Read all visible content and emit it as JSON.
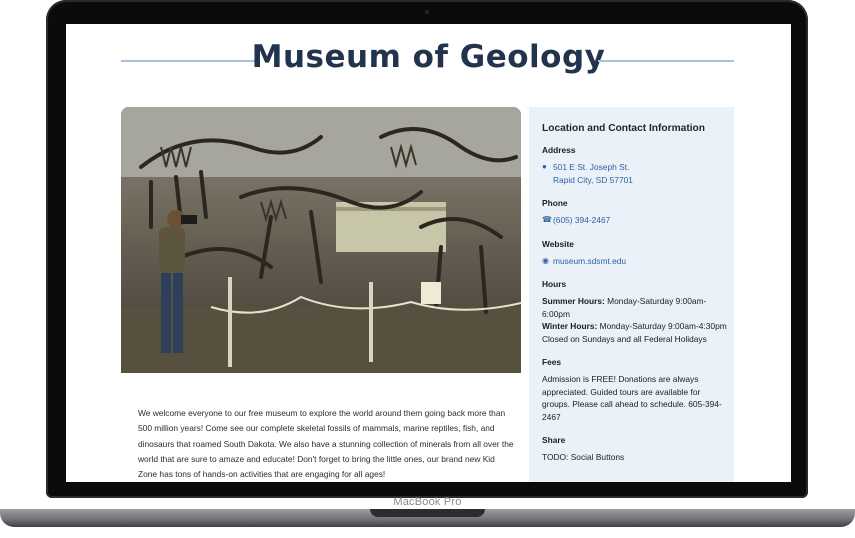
{
  "device": {
    "label": "MacBook Pro"
  },
  "page": {
    "title": "Museum of Geology"
  },
  "hero": {
    "alt": "Fossil skeletons exhibit with a visitor photographing"
  },
  "intro": {
    "text": "We welcome everyone to our free museum to explore the world around them going back more than 500 million years! Come see our complete skeletal fossils of mammals, marine reptiles, fish, and dinosaurs that roamed South Dakota. We also have a stunning collection of minerals from all over the world that are sure to amaze and educate! Don't forget to bring the little ones, our brand new Kid Zone has tons of hands-on activities that are engaging for all ages!"
  },
  "sidebar": {
    "title": "Location and Contact Information",
    "address": {
      "heading": "Address",
      "line1": "501 E St. Joseph St.",
      "line2": "Rapid City, SD 57701",
      "icon": "map-pin-icon"
    },
    "phone": {
      "heading": "Phone",
      "value": "(605) 394-2467",
      "icon": "phone-icon"
    },
    "website": {
      "heading": "Website",
      "value": "museum.sdsmt.edu",
      "icon": "globe-icon"
    },
    "hours": {
      "heading": "Hours",
      "summer_label": "Summer Hours:",
      "summer_value": " Monday-Saturday 9:00am-6:00pm",
      "winter_label": "Winter Hours:",
      "winter_value": " Monday-Saturday 9:00am-4:30pm",
      "closed": "Closed on Sundays and all Federal Holidays"
    },
    "fees": {
      "heading": "Fees",
      "text": "Admission is FREE! Donations are always appreciated. Guided tours are available for groups. Please call ahead to schedule. 605-394-2467"
    },
    "share": {
      "heading": "Share",
      "text": "TODO: Social Buttons"
    }
  },
  "colors": {
    "title": "#22344d",
    "accent_rule": "#a9c3de",
    "link": "#2d62a3",
    "sidebar_bg": "#eaf1f8"
  }
}
